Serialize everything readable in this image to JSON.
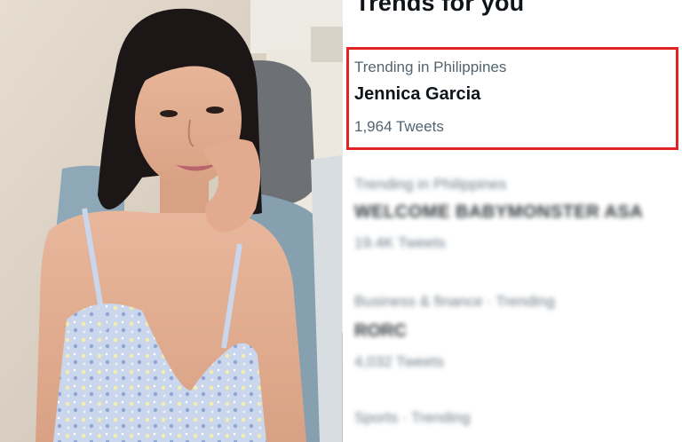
{
  "panel": {
    "title": "Trends for you"
  },
  "trends": [
    {
      "context": "Trending in Philippines",
      "name": "Jennica Garcia",
      "count": "1,964 Tweets",
      "highlighted": true
    },
    {
      "context": "Trending in Philippines",
      "name": "WELCOME BABYMONSTER ASA",
      "count": "19.4K Tweets",
      "blurred": true
    },
    {
      "context": "Business & finance · Trending",
      "name": "RORC",
      "count": "4,032 Tweets",
      "blurred": true
    },
    {
      "context": "Sports · Trending",
      "name": "",
      "count": "",
      "blurred": true
    }
  ],
  "colors": {
    "highlight_border": "#e02424",
    "secondary_text": "#536471",
    "primary_text": "#0f1419"
  }
}
